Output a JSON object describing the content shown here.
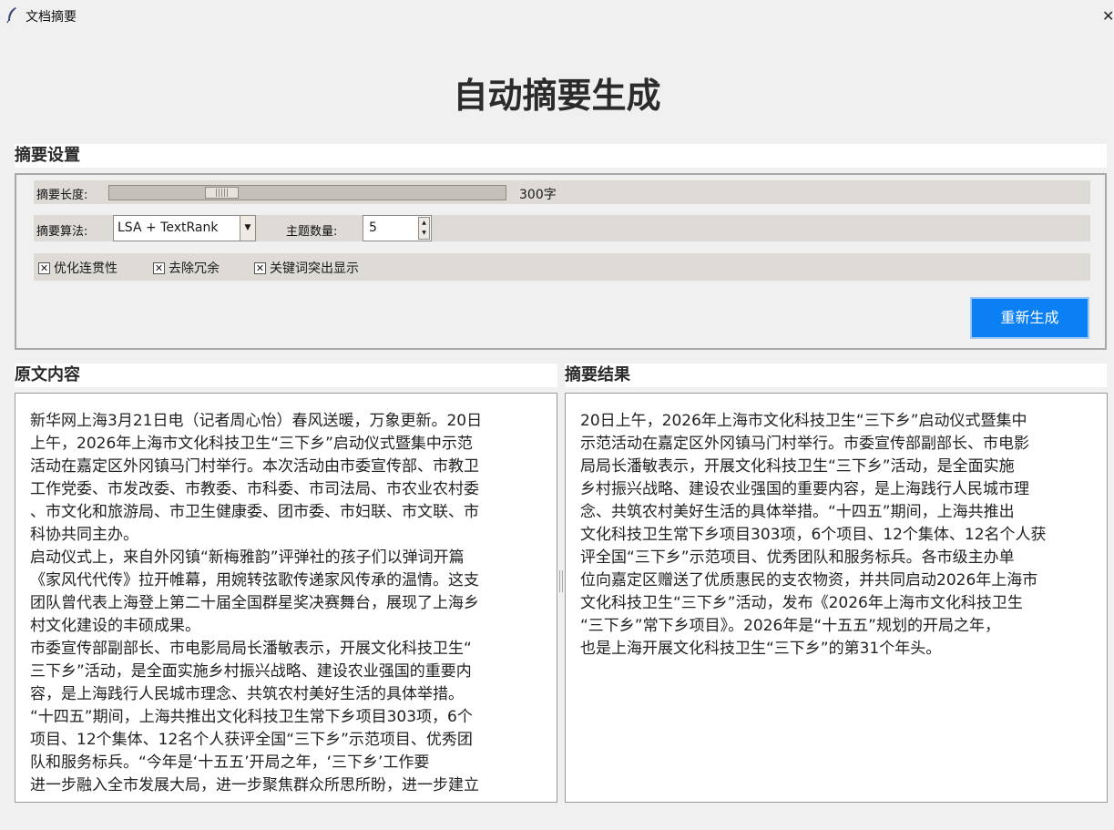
{
  "window": {
    "title": "文档摘要",
    "close_glyph": "✕"
  },
  "main_title": "自动摘要生成",
  "settings": {
    "section_label": "摘要设置",
    "length": {
      "label": "摘要长度:",
      "value_text": "300字",
      "slider_fraction": 0.22
    },
    "algorithm": {
      "label": "摘要算法:",
      "selected": "LSA + TextRank"
    },
    "topics": {
      "label": "主题数量:",
      "value": "5"
    },
    "options": [
      {
        "label": "优化连贯性",
        "checked": true
      },
      {
        "label": "去除冗余",
        "checked": true
      },
      {
        "label": "关键词突出显示",
        "checked": true
      }
    ],
    "regenerate_label": "重新生成"
  },
  "original": {
    "section_label": "原文内容",
    "text": "新华网上海3月21日电（记者周心怡）春风送暖，万象更新。20日\n上午，2026年上海市文化科技卫生“三下乡”启动仪式暨集中示范\n活动在嘉定区外冈镇马门村举行。本次活动由市委宣传部、市教卫\n工作党委、市发改委、市教委、市科委、市司法局、市农业农村委\n、市文化和旅游局、市卫生健康委、团市委、市妇联、市文联、市\n科协共同主办。\n启动仪式上，来自外冈镇“新梅雅韵”评弹社的孩子们以弹词开篇\n《家风代代传》拉开帷幕，用婉转弦歌传递家风传承的温情。这支\n团队曾代表上海登上第二十届全国群星奖决赛舞台，展现了上海乡\n村文化建设的丰硕成果。\n市委宣传部副部长、市电影局局长潘敏表示，开展文化科技卫生“\n三下乡”活动，是全面实施乡村振兴战略、建设农业强国的重要内\n容，是上海践行人民城市理念、共筑农村美好生活的具体举措。\n“十四五”期间，上海共推出文化科技卫生常下乡项目303项，6个\n项目、12个集体、12名个人获评全国“三下乡”示范项目、优秀团\n队和服务标兵。“今年是‘十五五’开局之年，‘三下乡’工作要\n进一步融入全市发展大局，进一步聚焦群众所思所盼，进一步建立"
  },
  "summary": {
    "section_label": "摘要结果",
    "text": "20日上午，2026年上海市文化科技卫生“三下乡”启动仪式暨集中\n示范活动在嘉定区外冈镇马门村举行。市委宣传部副部长、市电影\n局局长潘敏表示，开展文化科技卫生“三下乡”活动，是全面实施\n乡村振兴战略、建设农业强国的重要内容，是上海践行人民城市理\n念、共筑农村美好生活的具体举措。“十四五”期间，上海共推出\n文化科技卫生常下乡项目303项，6个项目、12个集体、12名个人获\n评全国“三下乡”示范项目、优秀团队和服务标兵。各市级主办单\n位向嘉定区赠送了优质惠民的支农物资，并共同启动2026年上海市\n文化科技卫生“三下乡”活动，发布《2026年上海市文化科技卫生\n“三下乡”常下乡项目》。2026年是“十五五”规划的开局之年，\n也是上海开展文化科技卫生“三下乡”的第31个年头。"
  }
}
